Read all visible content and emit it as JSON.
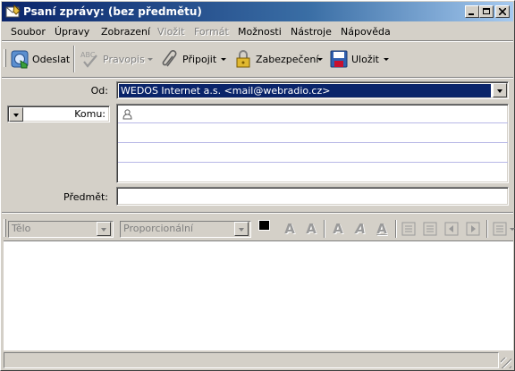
{
  "window": {
    "title": "Psaní zprávy: (bez předmětu)"
  },
  "menu": {
    "items": [
      {
        "label": "Soubor",
        "enabled": true
      },
      {
        "label": "Úpravy",
        "enabled": true
      },
      {
        "label": "Zobrazení",
        "enabled": true
      },
      {
        "label": "Vložit",
        "enabled": false
      },
      {
        "label": "Formát",
        "enabled": false
      },
      {
        "label": "Možnosti",
        "enabled": true
      },
      {
        "label": "Nástroje",
        "enabled": true
      },
      {
        "label": "Nápověda",
        "enabled": true
      }
    ]
  },
  "toolbar": {
    "send_label": "Odeslat",
    "spell_label": "Pravopis",
    "attach_label": "Připojit",
    "security_label": "Zabezpečení",
    "save_label": "Uložit"
  },
  "header": {
    "from_label": "Od:",
    "from_value": "WEDOS Internet a.s. <mail@webradio.cz>",
    "to_label": "Komu:",
    "subject_label": "Předmět:",
    "subject_value": ""
  },
  "format": {
    "style_value": "Tělo",
    "font_value": "Proporcionální",
    "text_color": "#000000"
  },
  "colors": {
    "titlebar_start": "#0a246a",
    "titlebar_end": "#a6caf0",
    "selection": "#0a246a"
  }
}
